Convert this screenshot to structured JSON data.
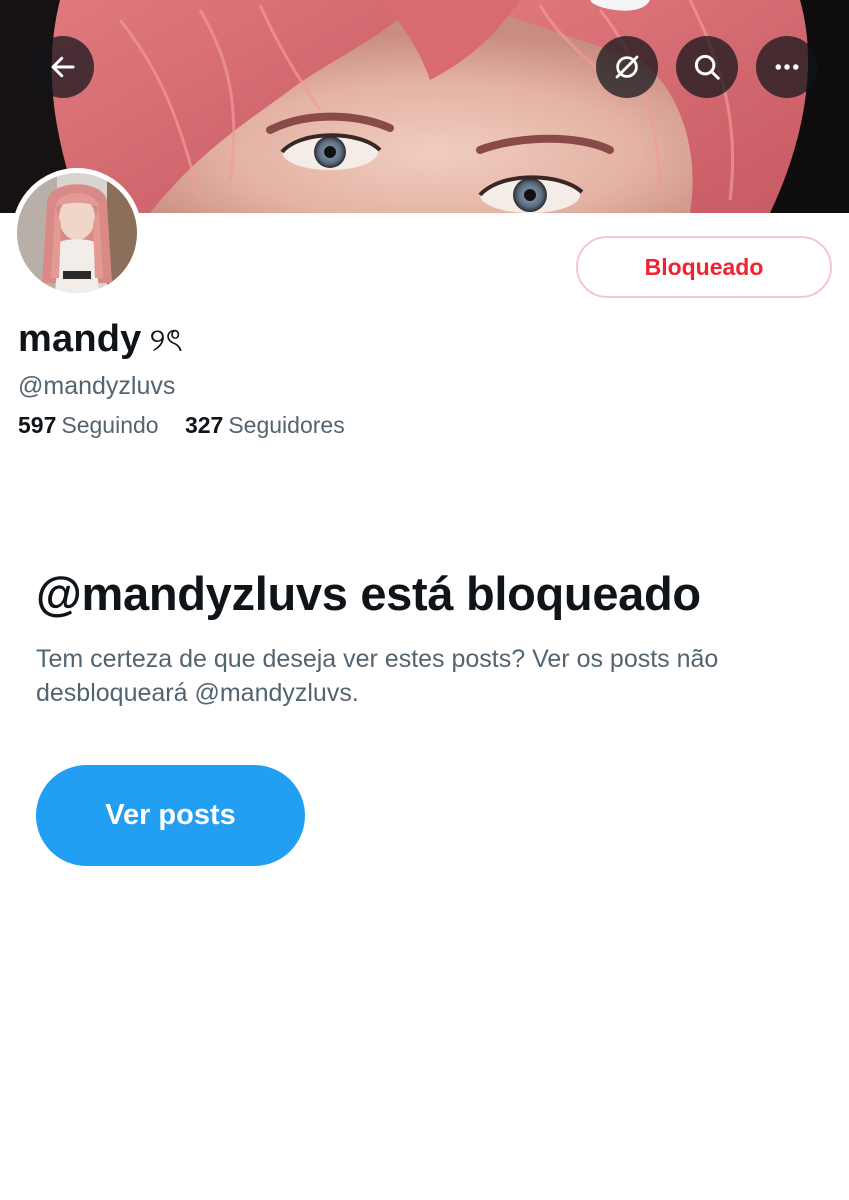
{
  "profile": {
    "display_name": "mandy",
    "name_decoration": "୨ৎ",
    "handle": "@mandyzluvs",
    "following_count": "597",
    "following_label": "Seguindo",
    "followers_count": "327",
    "followers_label": "Seguidores"
  },
  "actions": {
    "blocked_label": "Bloqueado",
    "view_posts_label": "Ver posts"
  },
  "notice": {
    "title": "@mandyzluvs está bloqueado",
    "description": "Tem certeza de que deseja ver estes posts? Ver os posts não desbloqueará @mandyzluvs."
  },
  "icons": {
    "back": "arrow-left-icon",
    "grok": "grok-icon",
    "search": "search-icon",
    "more": "more-horizontal-icon"
  },
  "colors": {
    "accent": "#1d9bf0",
    "blocked_red": "#f4212e",
    "secondary_text": "#536471",
    "primary_text": "#0f1419"
  }
}
